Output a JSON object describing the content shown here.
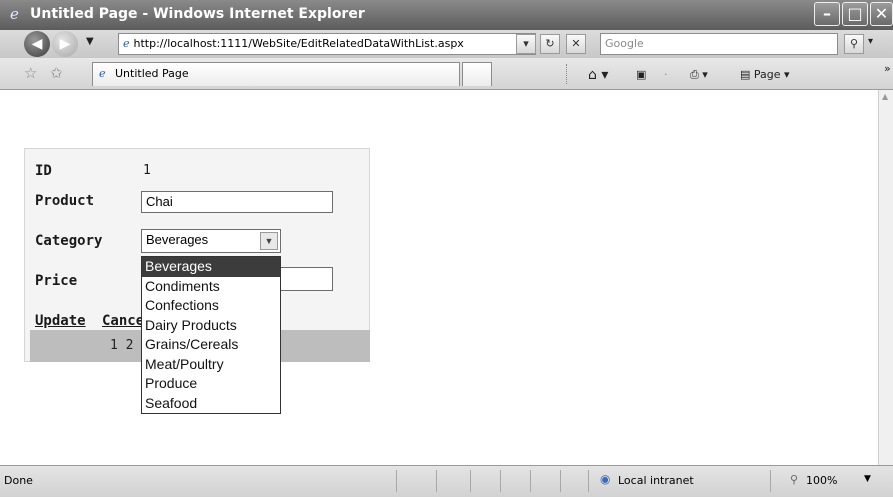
{
  "window": {
    "title": "Untitled Page - Windows Internet Explorer"
  },
  "address_bar": {
    "url": "http://localhost:1111/WebSite/EditRelatedDataWithList.aspx",
    "search_placeholder": "Google"
  },
  "tab": {
    "label": "Untitled Page"
  },
  "toolbar": {
    "page_label": "Page"
  },
  "form": {
    "id_label": "ID",
    "id_value": "1",
    "product_label": "Product",
    "product_value": "Chai",
    "category_label": "Category",
    "category_value": "Beverages",
    "price_label": "Price",
    "update_link": "Update",
    "cancel_link": "Cancel",
    "pager_text": "1 2"
  },
  "category_options": [
    "Beverages",
    "Condiments",
    "Confections",
    "Dairy Products",
    "Grains/Cereals",
    "Meat/Poultry",
    "Produce",
    "Seafood"
  ],
  "status_bar": {
    "status_text": "Done",
    "zone": "Local intranet",
    "zoom": "100%"
  }
}
